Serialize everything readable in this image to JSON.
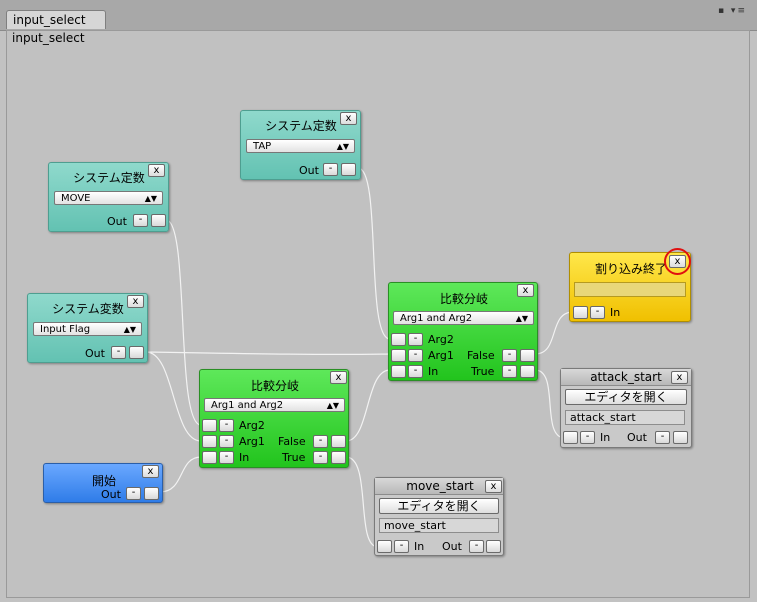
{
  "window": {
    "tab_label": "input_select",
    "canvas_title": "input_select",
    "window_icons": "▪ ▾≡"
  },
  "nodes": {
    "sysconst_tap": {
      "title": "システム定数",
      "close": "x",
      "select": "TAP",
      "out_label": "Out",
      "minus": "-"
    },
    "sysconst_move": {
      "title": "システム定数",
      "close": "x",
      "select": "MOVE",
      "out_label": "Out",
      "minus": "-"
    },
    "sysvar_input": {
      "title": "システム変数",
      "close": "x",
      "select": "Input Flag",
      "out_label": "Out",
      "minus": "-"
    },
    "compare_upper": {
      "title": "比較分岐",
      "close": "x",
      "select": "Arg1 and Arg2",
      "arg2": "Arg2",
      "arg1": "Arg1",
      "in_label": "In",
      "false_label": "False",
      "true_label": "True",
      "minus": "-"
    },
    "compare_lower": {
      "title": "比較分岐",
      "close": "x",
      "select": "Arg1 and Arg2",
      "arg2": "Arg2",
      "arg1": "Arg1",
      "in_label": "In",
      "false_label": "False",
      "true_label": "True",
      "minus": "-"
    },
    "start": {
      "title": "開始",
      "close": "x",
      "out_label": "Out",
      "minus": "-"
    },
    "interrupt_end": {
      "title": "割り込み終了",
      "close": "x",
      "field_value": "",
      "in_label": "In",
      "minus": "-"
    },
    "attack_start": {
      "title": "attack_start",
      "close": "x",
      "open_editor": "エディタを開く",
      "field_value": "attack_start",
      "in_label": "In",
      "out_label": "Out",
      "minus": "-"
    },
    "move_start": {
      "title": "move_start",
      "close": "x",
      "open_editor": "エディタを開く",
      "field_value": "move_start",
      "in_label": "In",
      "out_label": "Out",
      "minus": "-"
    }
  },
  "colors": {
    "const_node": "#63c2b2",
    "branch_node": "#22c41d",
    "start_node": "#2f7ce8",
    "end_node": "#f0c000",
    "highlight_ring": "#e01010"
  }
}
